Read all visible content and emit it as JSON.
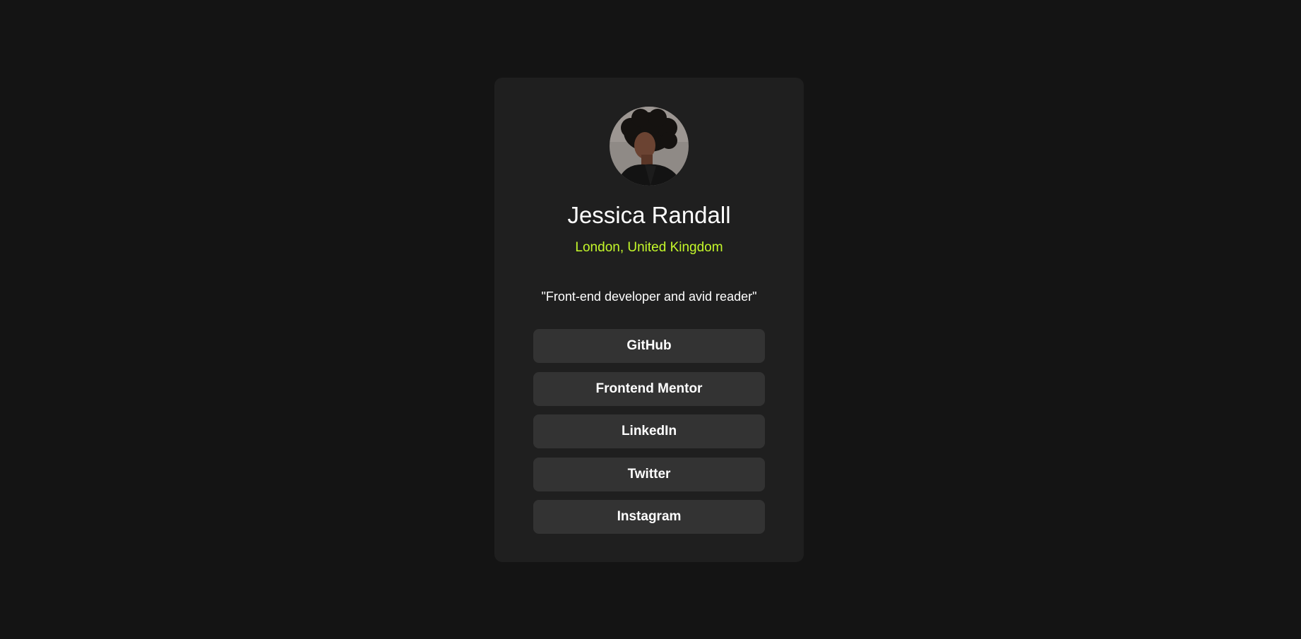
{
  "profile": {
    "avatar_alt": "Jessica Randall",
    "name": "Jessica Randall",
    "location": "London, United Kingdom",
    "bio": "\"Front-end developer and avid reader\""
  },
  "links": [
    {
      "label": "GitHub"
    },
    {
      "label": "Frontend Mentor"
    },
    {
      "label": "LinkedIn"
    },
    {
      "label": "Twitter"
    },
    {
      "label": "Instagram"
    }
  ],
  "colors": {
    "page_background": "#141414",
    "card_background": "#1f1f1f",
    "button_background": "#333333",
    "accent": "#c4f82a",
    "text": "#ffffff"
  }
}
